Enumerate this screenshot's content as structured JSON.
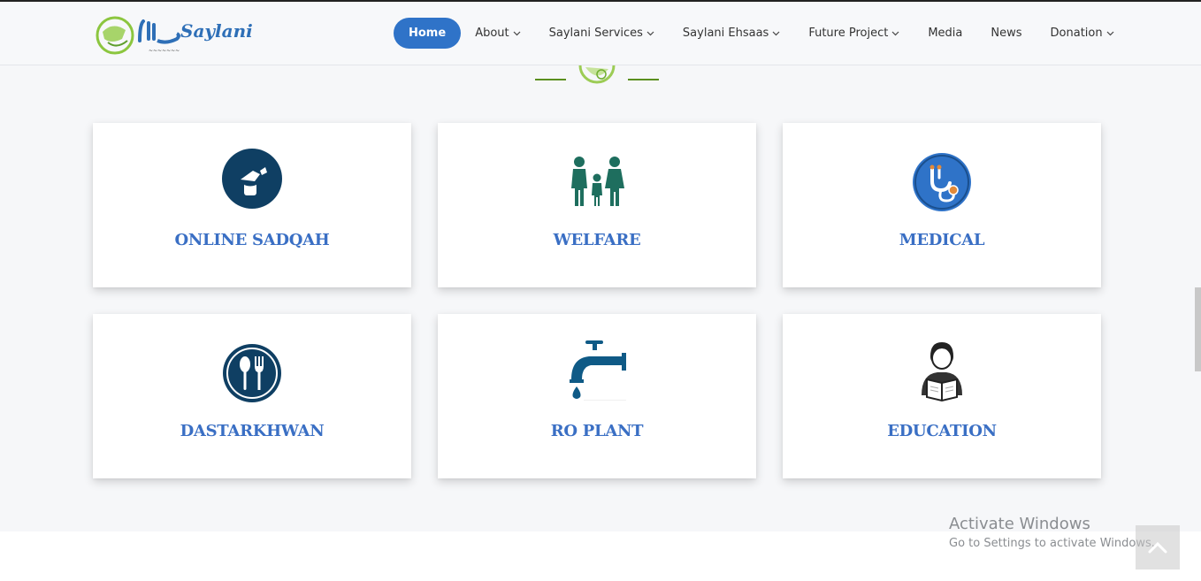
{
  "header": {
    "logo_text": "Saylani",
    "nav": [
      {
        "label": "Home",
        "active": true,
        "dropdown": false
      },
      {
        "label": "About",
        "dropdown": true
      },
      {
        "label": "Saylani Services",
        "dropdown": true
      },
      {
        "label": "Saylani Ehsaas",
        "dropdown": true
      },
      {
        "label": "Future Project",
        "dropdown": true
      },
      {
        "label": "Media",
        "dropdown": false
      },
      {
        "label": "News",
        "dropdown": false
      },
      {
        "label": "Donation",
        "dropdown": true
      }
    ]
  },
  "services": [
    {
      "title": "ONLINE SADQAH",
      "icon": "donation-icon"
    },
    {
      "title": "WELFARE",
      "icon": "family-icon"
    },
    {
      "title": "MEDICAL",
      "icon": "stethoscope-icon"
    },
    {
      "title": "DASTARKHWAN",
      "icon": "spoon-fork-icon"
    },
    {
      "title": "RO PLANT",
      "icon": "water-tap-icon"
    },
    {
      "title": "EDUCATION",
      "icon": "student-reading-icon"
    }
  ],
  "watermark": {
    "title": "Activate Windows",
    "subtitle": "Go to Settings to activate Windows."
  },
  "colors": {
    "accent": "#2f73c8",
    "card_title": "#3a6fc4",
    "brand_green": "#7cb83a",
    "welfare_teal": "#1e6e5e",
    "icon_navy": "#0f3f63"
  }
}
